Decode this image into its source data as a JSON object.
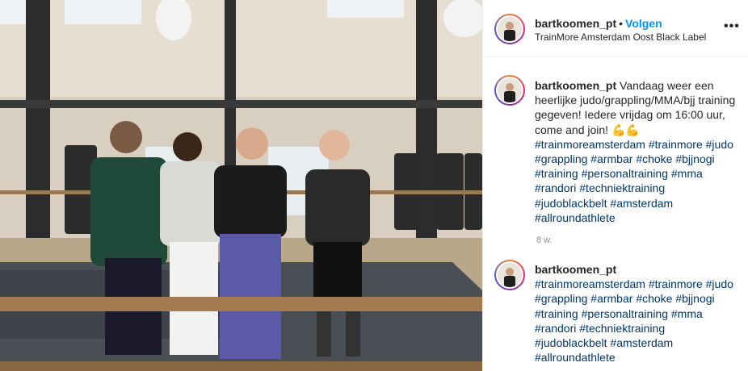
{
  "post": {
    "username": "bartkoomen_pt",
    "separator": "•",
    "follow_label": "Volgen",
    "location": "TrainMore Amsterdam Oost Black Label",
    "more_icon": "more-horizontal-icon",
    "more_glyph": "•••"
  },
  "caption": {
    "username": "bartkoomen_pt",
    "text_before": "Vandaag weer een heerlijke judo/grappling/MMA/bjj training gegeven! Iedere vrijdag om 16:00 uur, come and join!",
    "emoji": "💪💪",
    "hashtags": [
      "#trainmoreamsterdam",
      "#trainmore",
      "#judo",
      "#grappling",
      "#armbar",
      "#choke",
      "#bjjnogi",
      "#training",
      "#personaltraining",
      "#mma",
      "#randori",
      "#techniektraining",
      "#judoblackbelt",
      "#amsterdam",
      "#allroundathlete"
    ],
    "timestamp": "8 w."
  },
  "comment": {
    "username": "bartkoomen_pt",
    "hashtags": [
      "#trainmoreamsterdam",
      "#trainmore",
      "#judo",
      "#grappling",
      "#armbar",
      "#choke",
      "#bjjnogi",
      "#training",
      "#personaltraining",
      "#mma",
      "#randori",
      "#techniektraining",
      "#judoblackbelt",
      "#amsterdam",
      "#allroundathlete"
    ]
  },
  "colors": {
    "link_blue": "#0095f6",
    "hashtag": "#00376b",
    "muted": "#8e8e8e"
  }
}
